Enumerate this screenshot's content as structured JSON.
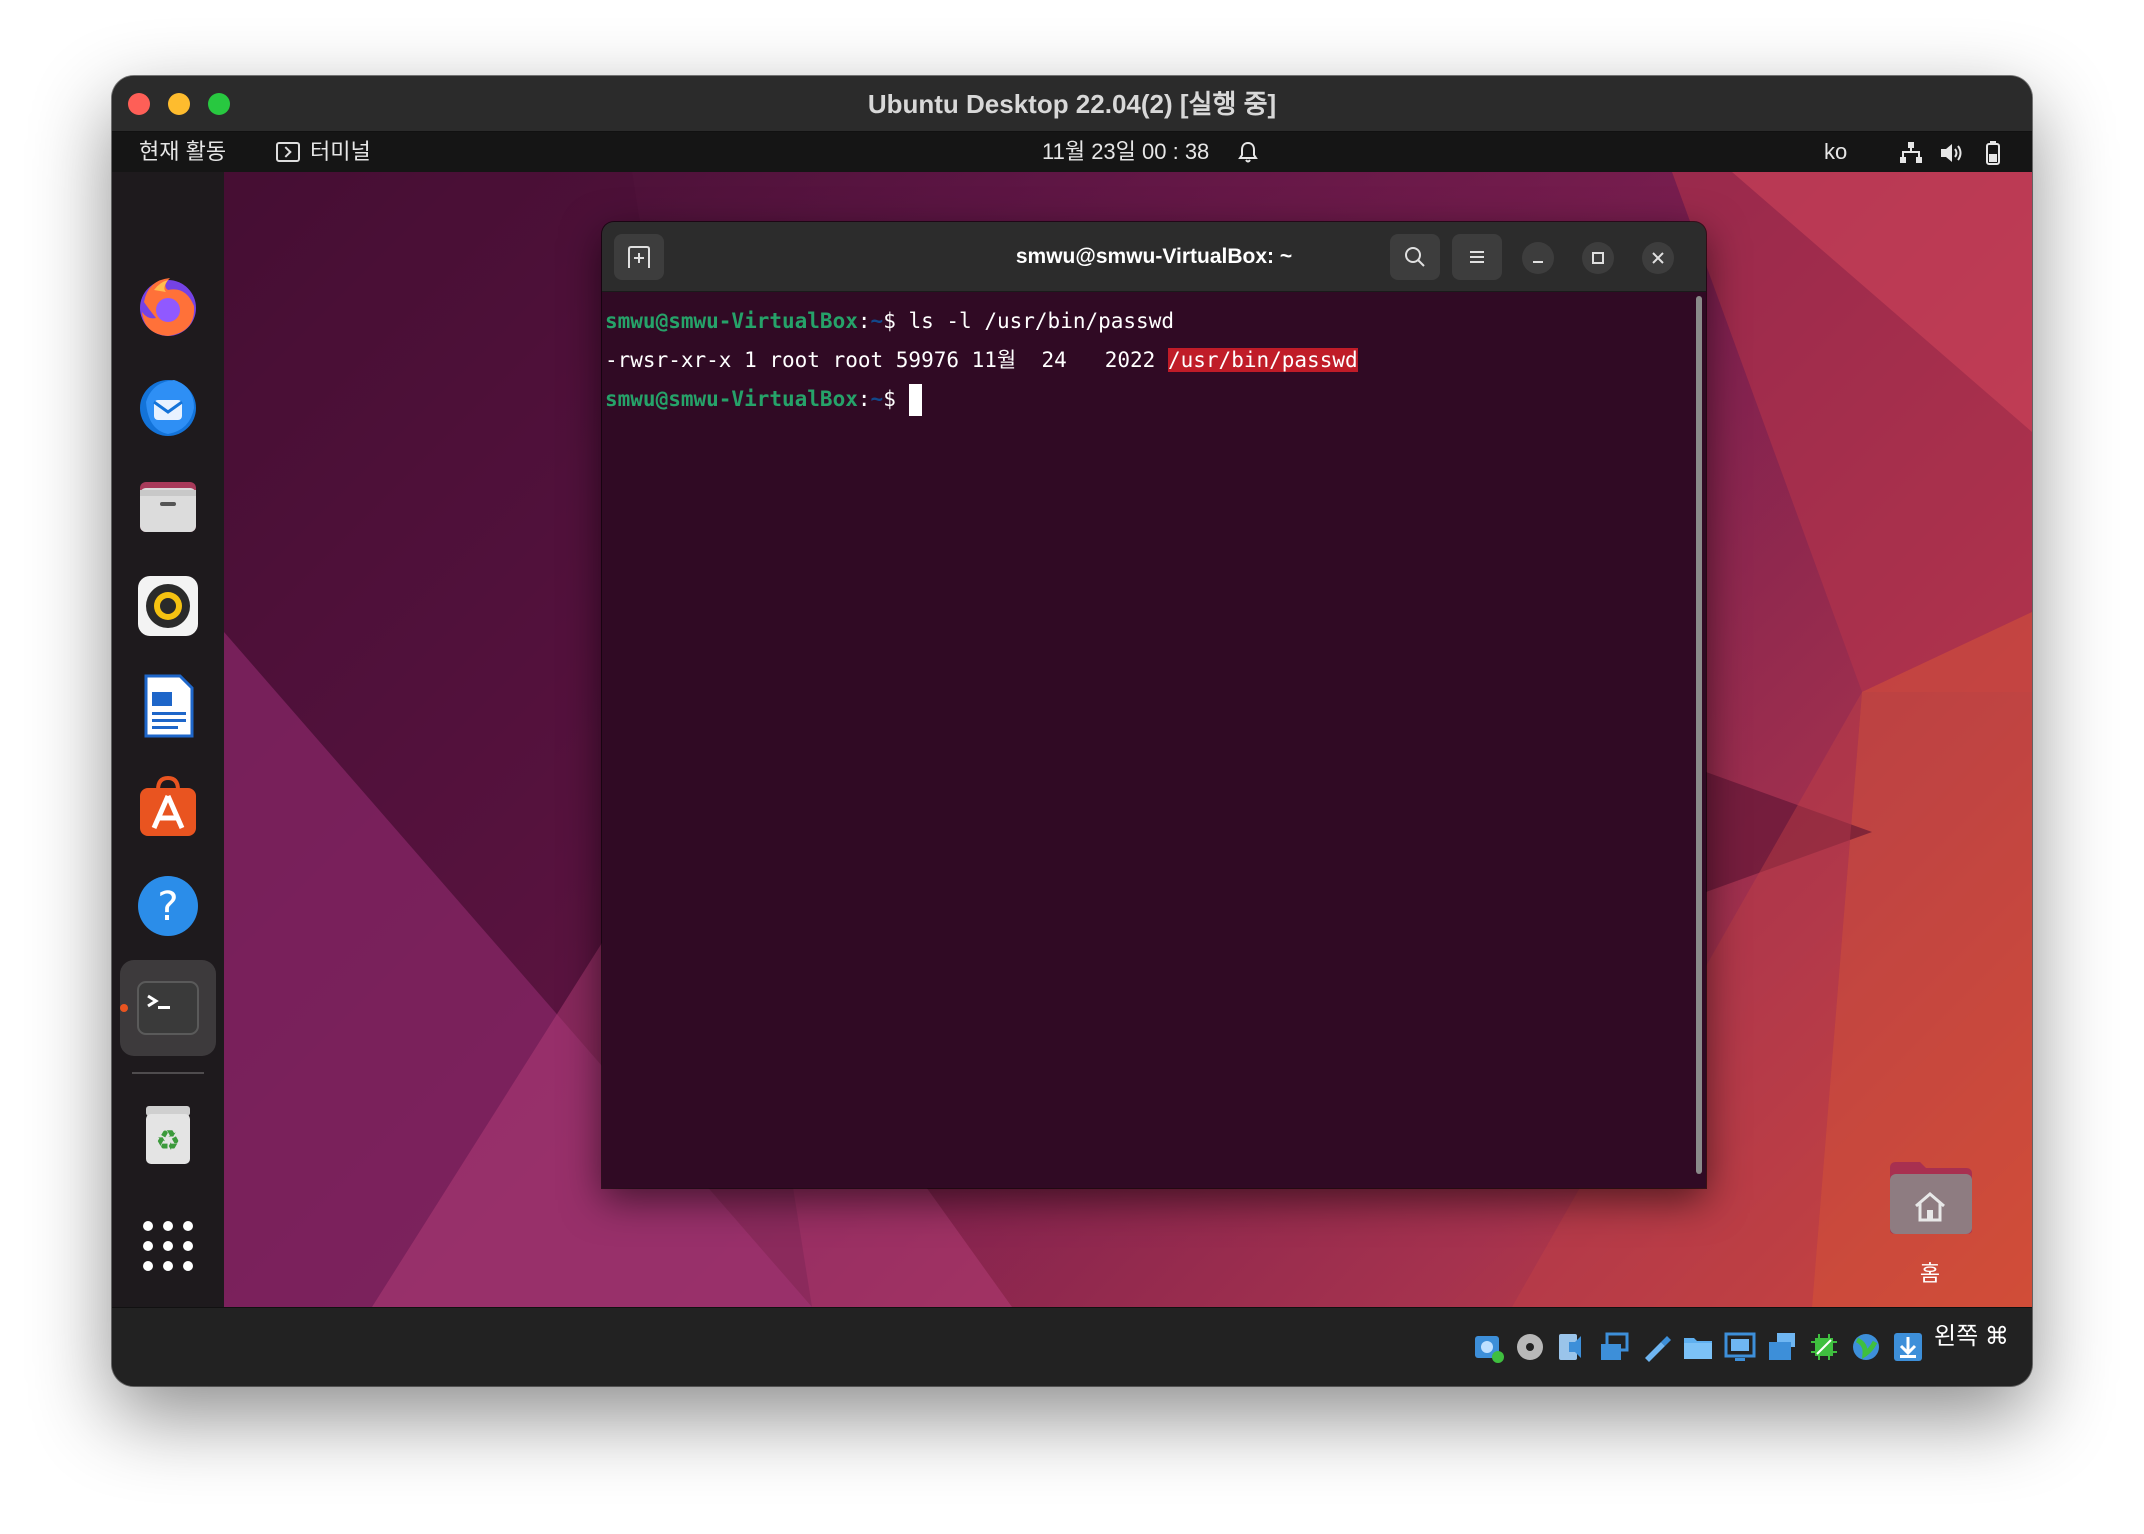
{
  "host_window": {
    "title": "Ubuntu Desktop 22.04(2) [실행 중]"
  },
  "topbar": {
    "activities": "현재 활동",
    "app_name": "터미널",
    "clock": "11월 23일  00 : 38",
    "language": "ko"
  },
  "dock": {
    "items": [
      "firefox",
      "thunderbird",
      "files",
      "rhythmbox",
      "libreoffice-writer",
      "app-center",
      "help",
      "terminal",
      "trash",
      "show-apps"
    ]
  },
  "terminal": {
    "title": "smwu@smwu-VirtualBox: ~",
    "lines": [
      {
        "prompt_user": "smwu@smwu-VirtualBox",
        "prompt_sep": ":",
        "prompt_path": "~",
        "prompt_end": "$ ",
        "command": "ls -l /usr/bin/passwd"
      },
      {
        "output": "-rwsr-xr-x 1 root root 59976 11월  24   2022 ",
        "highlighted": "/usr/bin/passwd"
      },
      {
        "prompt_user": "smwu@smwu-VirtualBox",
        "prompt_sep": ":",
        "prompt_path": "~",
        "prompt_end": "$ ",
        "command": ""
      }
    ]
  },
  "desktop": {
    "home_label": "홈"
  },
  "statusbar": {
    "host_key": "왼쪽 ⌘"
  },
  "colors": {
    "terminal_bg": "#300a24",
    "prompt_green": "#26a269",
    "prompt_blue": "#12488b",
    "highlight_red": "#c01c28",
    "ubuntu_orange": "#e95420"
  }
}
